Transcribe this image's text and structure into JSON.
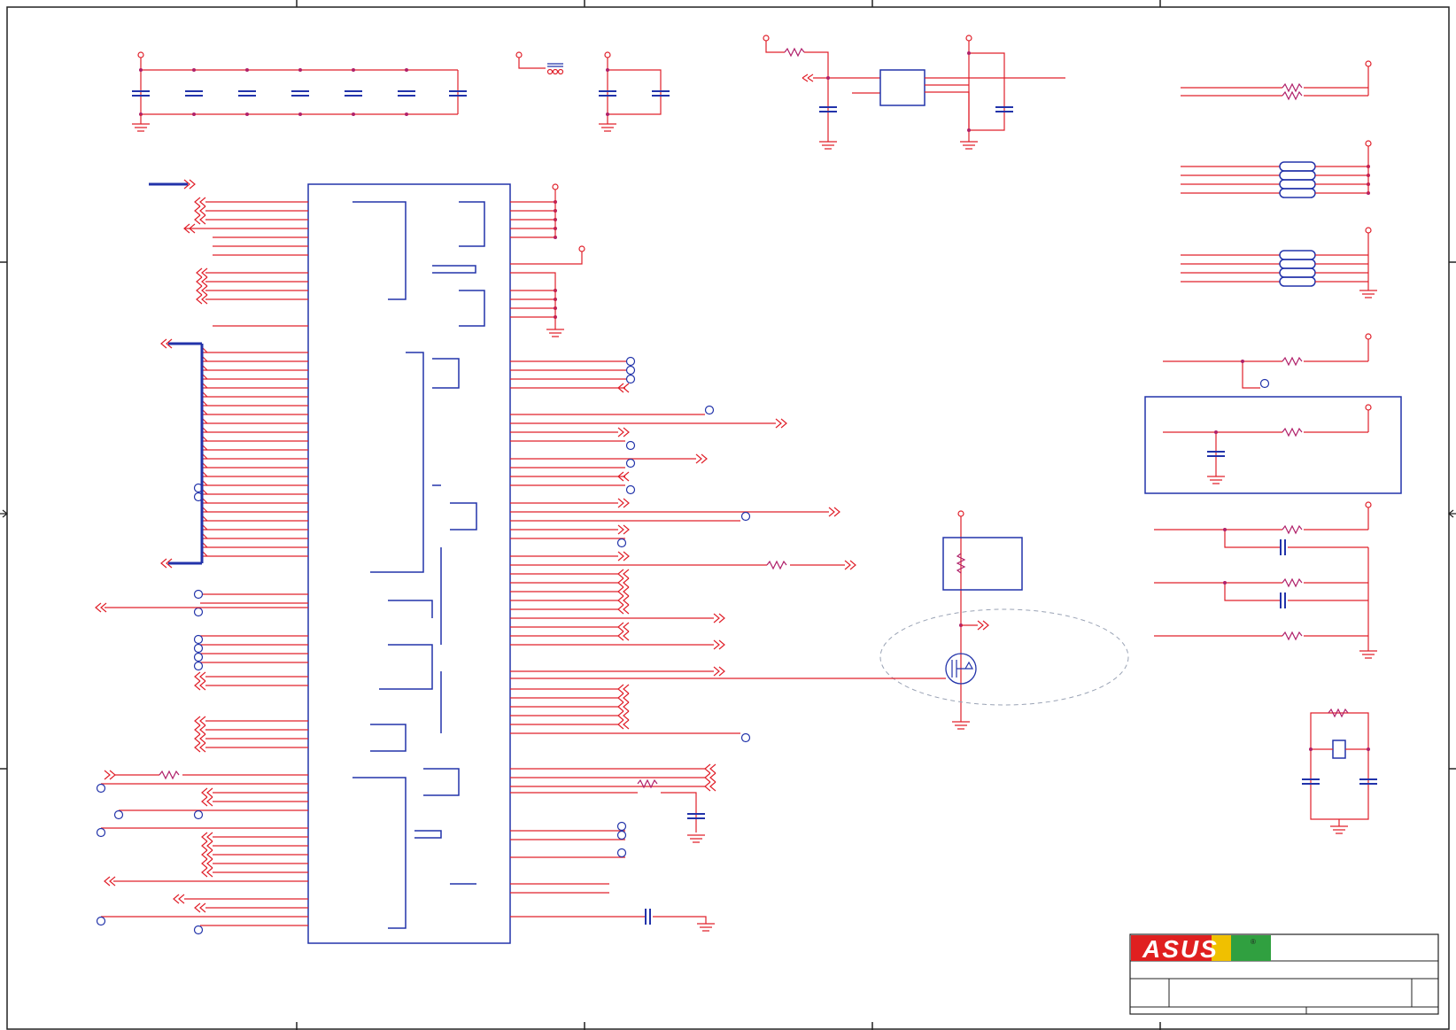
{
  "sheet": {
    "logo_text": "ASUS",
    "logo_mark": "®",
    "colors": {
      "wire": "#e0202a",
      "component": "#2233aa",
      "junction": "#b0206a",
      "logo_red": "#e02020",
      "logo_yellow": "#f0c000",
      "logo_green": "#30a040"
    }
  }
}
